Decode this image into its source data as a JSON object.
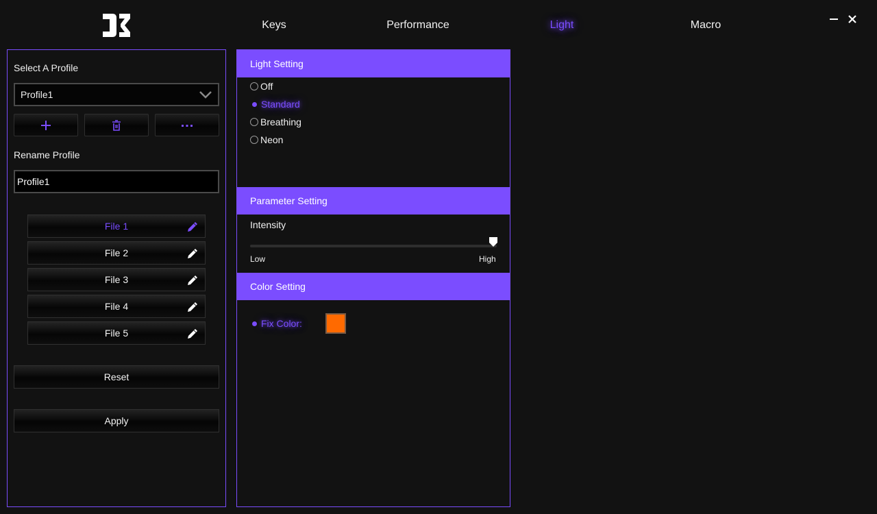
{
  "nav": {
    "tabs": [
      {
        "label": "Keys"
      },
      {
        "label": "Performance"
      },
      {
        "label": "Light"
      },
      {
        "label": "Macro"
      }
    ],
    "active_tab": "Light"
  },
  "window": {
    "minimize_icon": "minimize-icon",
    "close_icon": "close-icon"
  },
  "profile": {
    "select_label": "Select A Profile",
    "selected": "Profile1",
    "add_icon": "plus-icon",
    "delete_icon": "trash-icon",
    "more_icon": "ellipsis-icon",
    "rename_label": "Rename Profile",
    "rename_value": "Profile1",
    "files": [
      {
        "label": "File 1",
        "active": true
      },
      {
        "label": "File 2",
        "active": false
      },
      {
        "label": "File 3",
        "active": false
      },
      {
        "label": "File 4",
        "active": false
      },
      {
        "label": "File 5",
        "active": false
      }
    ],
    "reset_label": "Reset",
    "apply_label": "Apply"
  },
  "light": {
    "title": "Light Setting",
    "modes": [
      {
        "label": "Off",
        "selected": false
      },
      {
        "label": "Standard",
        "selected": true
      },
      {
        "label": "Breathing",
        "selected": false
      },
      {
        "label": "Neon",
        "selected": false
      }
    ]
  },
  "parameter": {
    "title": "Parameter Setting",
    "intensity_label": "Intensity",
    "intensity_value": 1.0,
    "low_label": "Low",
    "high_label": "High"
  },
  "color": {
    "title": "Color Setting",
    "fix_color_label": "Fix Color:",
    "fix_color_value": "#ff6a00"
  },
  "theme": {
    "accent": "#7b4dff",
    "background": "#121212"
  }
}
